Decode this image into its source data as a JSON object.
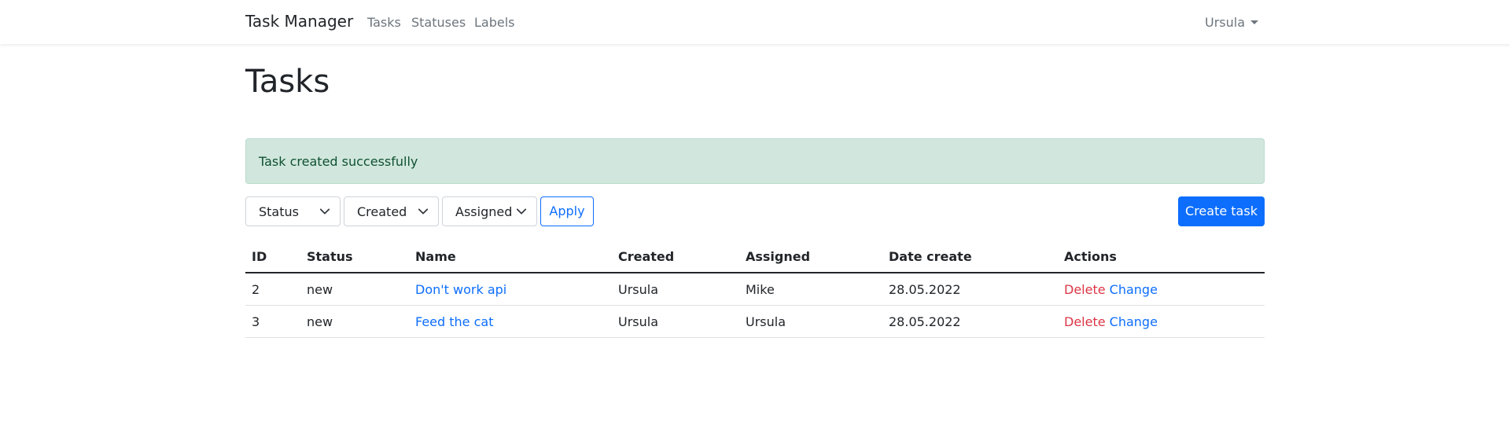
{
  "navbar": {
    "brand": "Task Manager",
    "links": [
      "Tasks",
      "Statuses",
      "Labels"
    ],
    "user": "Ursula"
  },
  "page": {
    "title": "Tasks",
    "alert": "Task created successfully"
  },
  "filters": {
    "status": "Status",
    "created": "Created",
    "assigned": "Assigned",
    "apply": "Apply",
    "create": "Create task"
  },
  "table": {
    "headers": [
      "ID",
      "Status",
      "Name",
      "Created",
      "Assigned",
      "Date create",
      "Actions"
    ],
    "rows": [
      {
        "id": "2",
        "status": "new",
        "name": "Don't work api",
        "created": "Ursula",
        "assigned": "Mike",
        "date": "28.05.2022",
        "delete": "Delete",
        "change": "Change"
      },
      {
        "id": "3",
        "status": "new",
        "name": "Feed the cat",
        "created": "Ursula",
        "assigned": "Ursula",
        "date": "28.05.2022",
        "delete": "Delete",
        "change": "Change"
      }
    ]
  },
  "colors": {
    "primary": "#0d6efd",
    "danger": "#dc3545",
    "success_bg": "#d1e7dd",
    "success_text": "#0f5132"
  }
}
